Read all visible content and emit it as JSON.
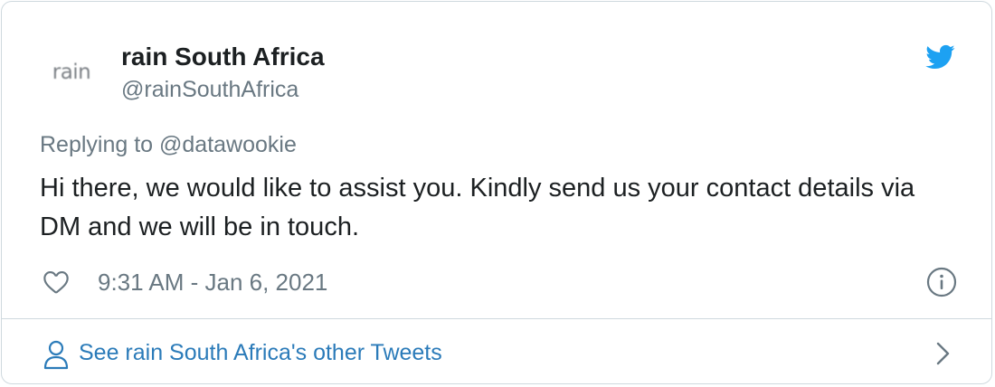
{
  "author": {
    "avatar_text": "rain",
    "display_name": "rain South Africa",
    "handle": "@rainSouthAfrica"
  },
  "tweet": {
    "replying_to": "Replying to @datawookie",
    "text": "Hi there, we would like to assist you. Kindly send us your contact details via DM and we will be in touch.",
    "timestamp": "9:31 AM - Jan 6, 2021"
  },
  "footer": {
    "more_tweets_label": "See rain South Africa's other Tweets"
  },
  "icons": {
    "brand": "twitter-bird-icon",
    "like": "heart-icon",
    "info": "info-icon",
    "profile": "person-icon",
    "next": "chevron-right-icon"
  },
  "colors": {
    "twitter_blue": "#1da1f2",
    "link_blue": "#2b7bb9",
    "muted_text": "#697882",
    "primary_text": "#1c2022",
    "border": "#cfd9de"
  }
}
